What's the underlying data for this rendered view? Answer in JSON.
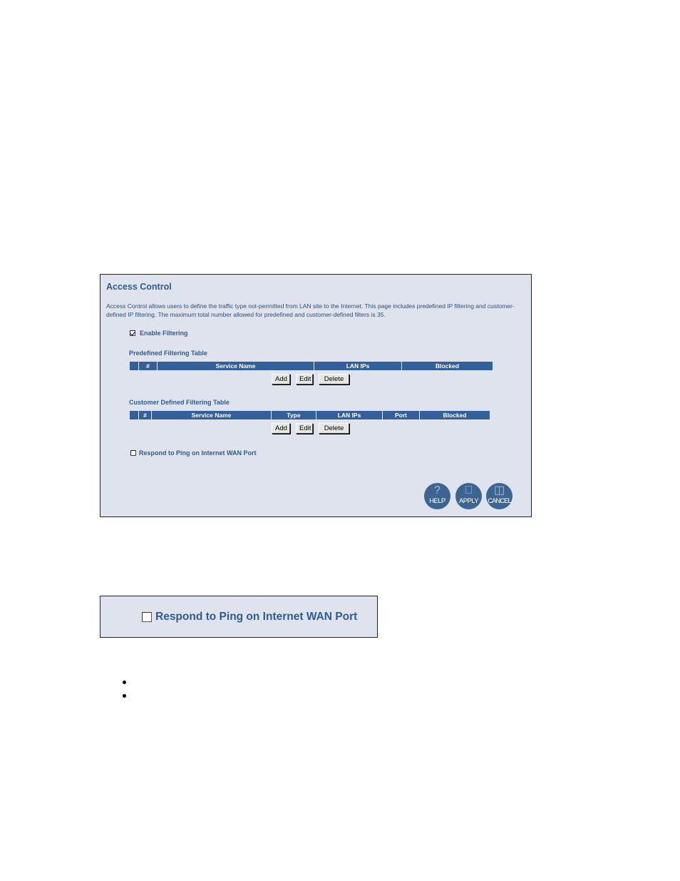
{
  "screenshot_main": {
    "title": "Access Control",
    "description": "Access Control allows users to define the traffic type not-permitted from LAN site to the Internet. This page includes predefined IP filtering and customer-defined IP filtering. The maximum total number allowed for predefined and customer-defined filters is 35.",
    "enable_filtering": {
      "label": "Enable Filtering",
      "checked": true
    },
    "predefined_table": {
      "title": "Predefined Filtering Table",
      "columns": [
        "",
        "#",
        "Service Name",
        "LAN IPs",
        "Blocked"
      ],
      "rows": [],
      "buttons": {
        "add": "Add",
        "edit": "Edit",
        "delete": "Delete"
      }
    },
    "customer_table": {
      "title": "Customer Defined Filtering Table",
      "columns": [
        "",
        "#",
        "Service Name",
        "Type",
        "LAN IPs",
        "Port",
        "Blocked"
      ],
      "rows": [],
      "buttons": {
        "add": "Add",
        "edit": "Edit",
        "delete": "Delete"
      }
    },
    "respond_ping": {
      "label": "Respond to Ping on Internet WAN Port",
      "checked": false
    },
    "action_buttons": {
      "help": {
        "label": "HELP",
        "icon": "question-icon"
      },
      "apply": {
        "label": "APPLY",
        "icon": "mouse-icon"
      },
      "cancel": {
        "label": "CANCEL",
        "icon": "trash-can-icon"
      }
    }
  },
  "screenshot_detail": {
    "respond_ping": {
      "label": "Respond to Ping on Internet WAN Port",
      "checked": false
    }
  },
  "bullets": [
    "",
    ""
  ],
  "colors": {
    "panel_bg": "#dfe3ee",
    "accent": "#2e5c8f",
    "table_header": "#33609a",
    "round_button": "#3c6592"
  }
}
